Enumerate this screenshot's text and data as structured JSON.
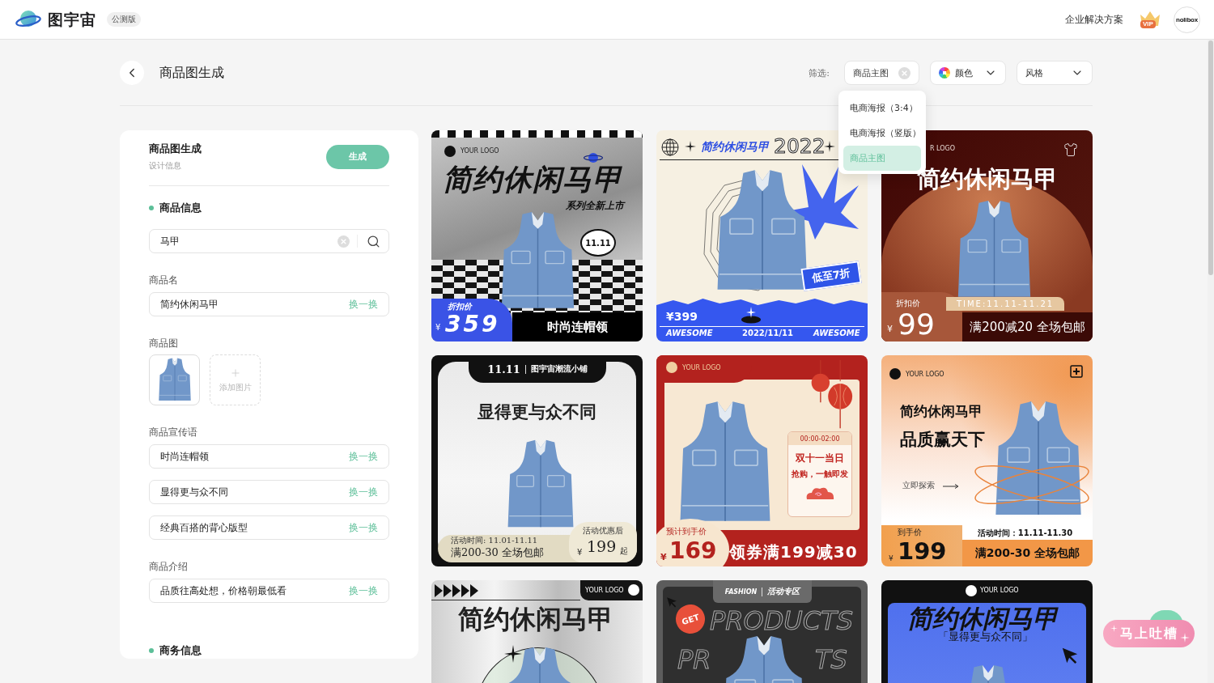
{
  "topbar": {
    "brand": "图宇宙",
    "badge": "公测版",
    "link": "企业解决方案",
    "vip": "VIP",
    "avatar": "nolibox"
  },
  "header": {
    "title": "商品图生成",
    "filter_label": "筛选:",
    "filters": [
      {
        "kind": "chip",
        "label": "商品主图",
        "menu": [
          {
            "label": "电商海报（3:4）",
            "selected": false
          },
          {
            "label": "电商海报（竖版）",
            "selected": false
          },
          {
            "label": "商品主图",
            "selected": true
          }
        ]
      },
      {
        "kind": "color",
        "label": "颜色"
      },
      {
        "kind": "select",
        "label": "风格"
      }
    ]
  },
  "form": {
    "title": "商品图生成",
    "subtitle": "设计信息",
    "generate": "生成",
    "sections": [
      {
        "title": "商品信息",
        "search": "马甲",
        "groups": [
          {
            "kind": "fields",
            "label": "商品名",
            "fields": [
              {
                "value": "简约休闲马甲",
                "action": "换一换"
              }
            ]
          },
          {
            "kind": "images",
            "label": "商品图",
            "add": "添加图片"
          },
          {
            "kind": "fields",
            "label": "商品宣传语",
            "fields": [
              {
                "value": "时尚连帽领",
                "action": "换一换"
              },
              {
                "value": "显得更与众不同",
                "action": "换一换"
              },
              {
                "value": "经典百搭的背心版型",
                "action": "换一换"
              }
            ]
          },
          {
            "kind": "fields",
            "label": "商品介绍",
            "fields": [
              {
                "value": "品质往高处想，价格朝最低看",
                "action": "换一换"
              }
            ]
          }
        ]
      },
      {
        "title": "商务信息"
      }
    ]
  },
  "results": [
    {
      "kind": "checker",
      "logo": "YOUR LOGO",
      "title": "简约休闲马甲",
      "subtitle": "系列全新上市",
      "bubble": "11.11",
      "price_label": "折扣价",
      "currency": "¥",
      "price": "359",
      "slogan": "时尚连帽领"
    },
    {
      "kind": "retro",
      "title": "简约休闲马甲",
      "year": "2022",
      "badge": "低至7折",
      "price": "¥399",
      "footer": [
        "AWESOME",
        "2022/11/11",
        "AWESOME"
      ]
    },
    {
      "kind": "arch",
      "logo": "R LOGO",
      "title": "简约休闲马甲",
      "price_label": "折扣价",
      "time": "TIME:11.11-11.21",
      "currency": "¥",
      "price": "99",
      "slogan": "满200减20 全场包邮"
    },
    {
      "kind": "stage",
      "tag": "11.11",
      "shop": "图宇宙潮流小铺",
      "title": "显得更与众不同",
      "time": "活动时间: 11.01-11.11",
      "slogan": "满200-30 全场包邮",
      "price_label": "活动优惠后",
      "currency": "¥",
      "price": "199",
      "suffix": "起"
    },
    {
      "kind": "festive",
      "logo": "YOUR LOGO",
      "time": "00:00-02:00",
      "title": "双十一当日",
      "subtitle": "抢购，一触即发",
      "price_label": "预计到手价",
      "currency": "¥",
      "price": "169",
      "slogan": "领券满199减30"
    },
    {
      "kind": "gradient",
      "logo": "YOUR LOGO",
      "title": "简约休闲马甲",
      "subtitle": "品质赢天下",
      "link": "立即探索",
      "price_label": "到手价",
      "currency": "¥",
      "price": "199",
      "time": "活动时间：11.11-11.30",
      "slogan": "满200-30 全场包邮"
    },
    {
      "kind": "metal",
      "logo": "YOUR LOGO",
      "title": "简约休闲马甲"
    },
    {
      "kind": "dark",
      "brand": "FASHION",
      "tag": "活动专区",
      "badge": "GET",
      "backdrop": [
        "PRODUCTS",
        "PR",
        "TS"
      ]
    },
    {
      "kind": "blue",
      "logo": "YOUR LOGO",
      "title": "简约休闲马甲",
      "subtitle": "「显得更与众不同」"
    }
  ],
  "feedback": "马上吐槽"
}
